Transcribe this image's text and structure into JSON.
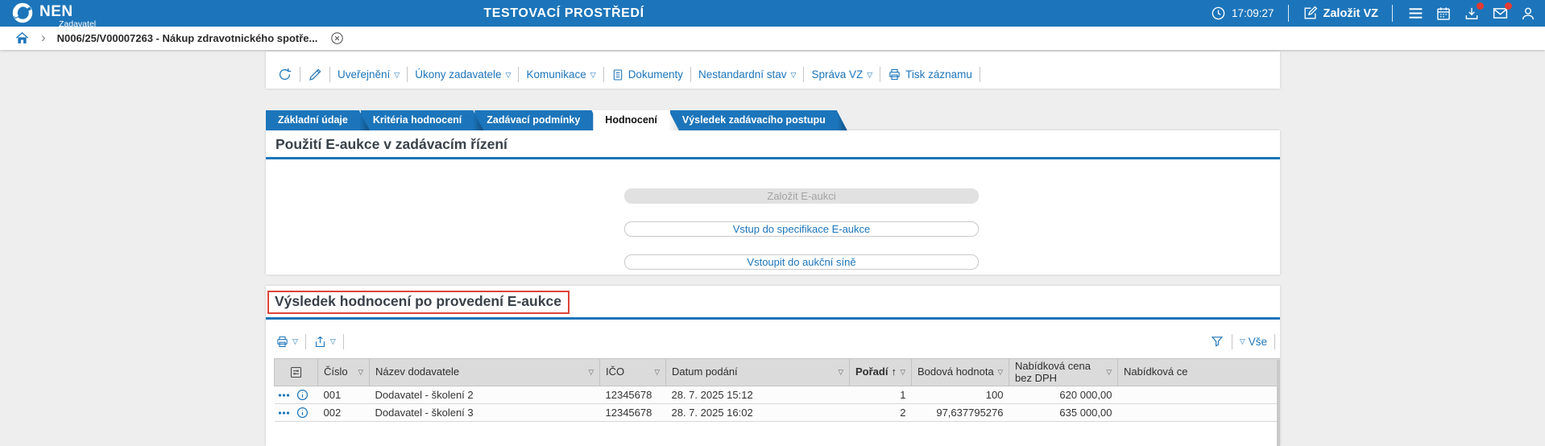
{
  "colors": {
    "accent": "#1c75ba",
    "highlight_red": "#dd443a",
    "notification_red": "#e23b33",
    "heading": "#394149"
  },
  "icons": {
    "dropdown": "▽",
    "chevron": "›",
    "sort_asc": "↑"
  },
  "topbar": {
    "brand": "NEN",
    "brand_sub": "Zadavatel",
    "env_title": "TESTOVACÍ PROSTŘEDÍ",
    "time": "17:09:27",
    "new_vz": "Založit VZ"
  },
  "breadcrumb": {
    "title": "N006/25/V00007263 - Nákup zdravotnického spotře..."
  },
  "record_toolbar": {
    "items": [
      {
        "label": "Uveřejnění",
        "dropdown": true
      },
      {
        "label": "Úkony zadavatele",
        "dropdown": true
      },
      {
        "label": "Komunikace",
        "dropdown": true
      },
      {
        "label": "Dokumenty",
        "dropdown": false
      },
      {
        "label": "Nestandardní stav",
        "dropdown": true
      },
      {
        "label": "Správa VZ",
        "dropdown": true
      },
      {
        "label": "Tisk záznamu",
        "dropdown": false
      }
    ]
  },
  "tabs": {
    "active_index": 3,
    "items": [
      {
        "label": "Základní údaje"
      },
      {
        "label": "Kritéria hodnocení"
      },
      {
        "label": "Zadávací podmínky"
      },
      {
        "label": "Hodnocení"
      },
      {
        "label": "Výsledek zadávacího postupu"
      }
    ]
  },
  "eauction": {
    "title": "Použití E-aukce v zadávacím řízení",
    "buttons": [
      {
        "label": "Založit E-aukci",
        "state": "disabled"
      },
      {
        "label": "Vstup do specifikace E-aukce",
        "state": "enabled"
      },
      {
        "label": "Vstoupit do aukční síně",
        "state": "enabled"
      }
    ]
  },
  "result": {
    "title": "Výsledek hodnocení po provedení E-aukce",
    "filter_all": "Vše",
    "table": {
      "columns": [
        {
          "label": "Číslo"
        },
        {
          "label": "Název dodavatele"
        },
        {
          "label": "IČO"
        },
        {
          "label": "Datum podání"
        },
        {
          "label": "Pořadí",
          "sorted": "ascending"
        },
        {
          "label": "Bodová hodnota"
        },
        {
          "label": "Nabídková cena bez DPH"
        },
        {
          "label": "Nabídková ce"
        }
      ],
      "rows": [
        {
          "cislo": "001",
          "nazev_dodavatele": "Dodavatel - školení 2",
          "ico": "12345678",
          "datum_podani": "28. 7. 2025 15:12",
          "poradi": "1",
          "bodova_hodnota": "100",
          "nabidkova_cena_bez_dph": "620 000,00"
        },
        {
          "cislo": "002",
          "nazev_dodavatele": "Dodavatel - školení 3",
          "ico": "12345678",
          "datum_podani": "28. 7. 2025 16:02",
          "poradi": "2",
          "bodova_hodnota": "97,637795276",
          "nabidkova_cena_bez_dph": "635 000,00"
        }
      ]
    }
  }
}
